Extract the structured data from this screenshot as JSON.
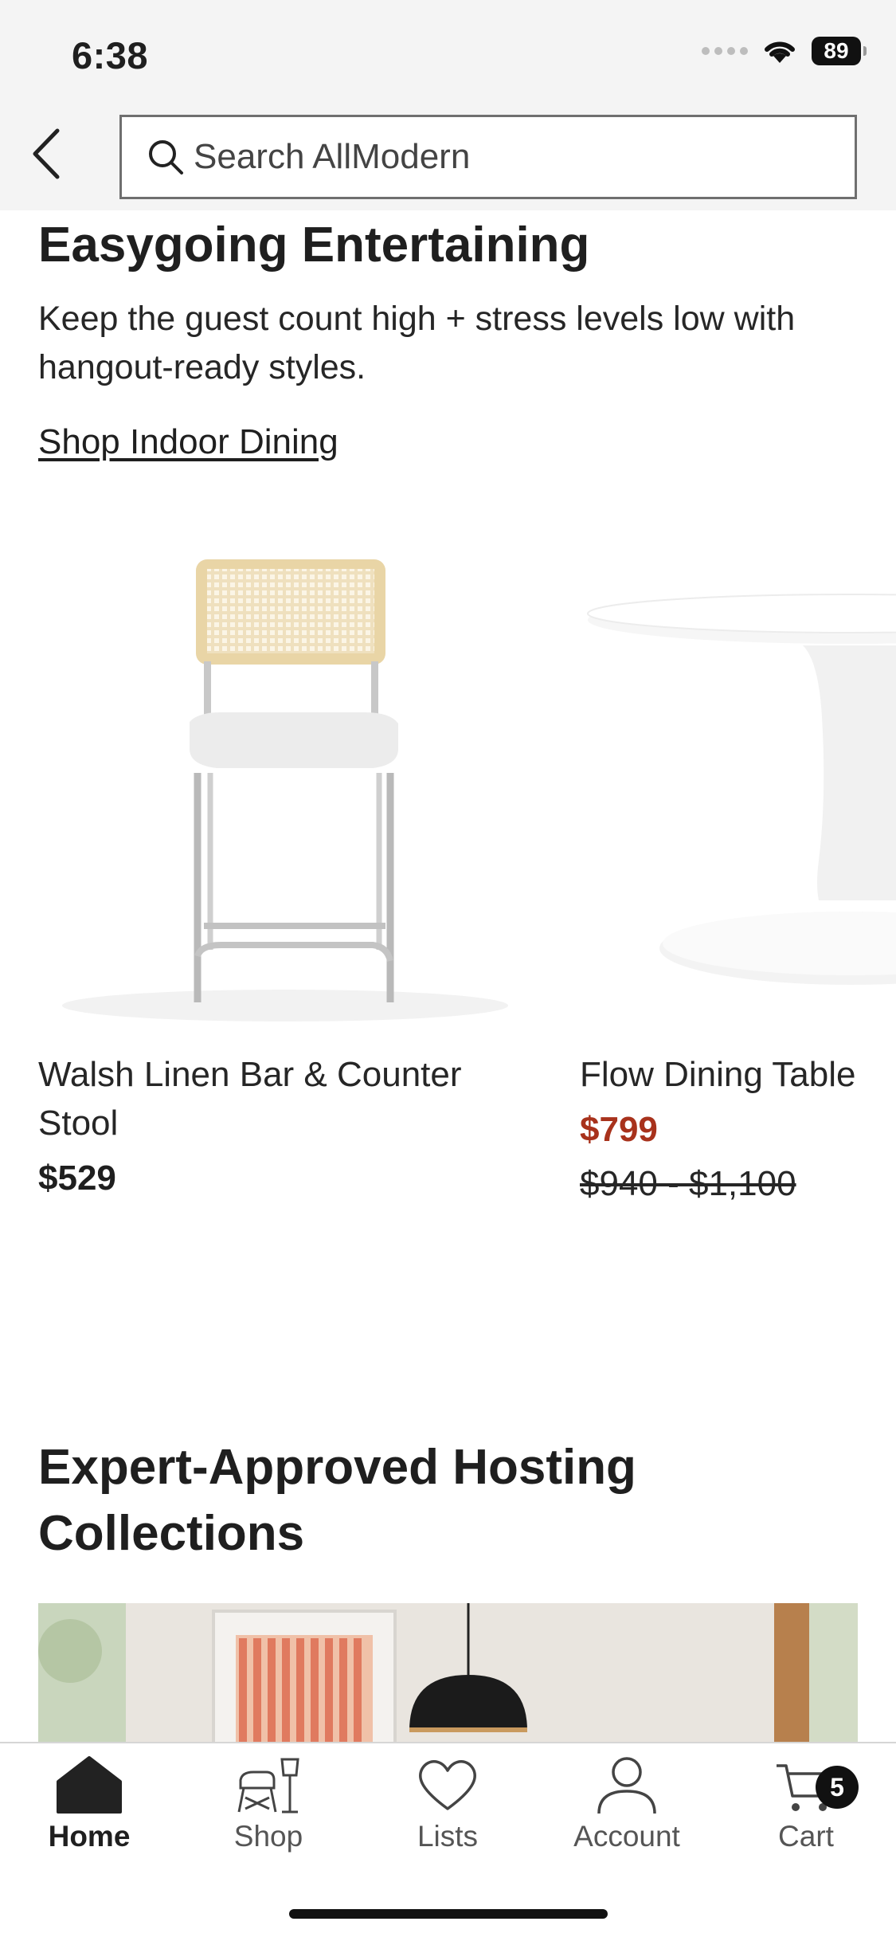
{
  "status_bar": {
    "time": "6:38",
    "battery": "89"
  },
  "header": {
    "search_placeholder": "Search AllModern"
  },
  "section_entertaining": {
    "title": "Easygoing Entertaining",
    "description": "Keep the guest count high + stress levels low with hangout-ready styles.",
    "link": "Shop Indoor Dining"
  },
  "products": [
    {
      "name": "Walsh Linen Bar & Counter Stool",
      "price": "$529"
    },
    {
      "name": "Flow Dining Table",
      "sale_price": "$799",
      "original_price": "$940 - $1,100"
    }
  ],
  "section_collections": {
    "title": "Expert-Approved Hosting Collections"
  },
  "tabbar": {
    "items": [
      {
        "label": "Home",
        "icon": "home-icon"
      },
      {
        "label": "Shop",
        "icon": "shop-icon"
      },
      {
        "label": "Lists",
        "icon": "heart-icon"
      },
      {
        "label": "Account",
        "icon": "account-icon"
      },
      {
        "label": "Cart",
        "icon": "cart-icon",
        "badge": "5"
      }
    ]
  },
  "colors": {
    "sale_price": "#a8321c",
    "header_bg": "#f4f4f4"
  }
}
